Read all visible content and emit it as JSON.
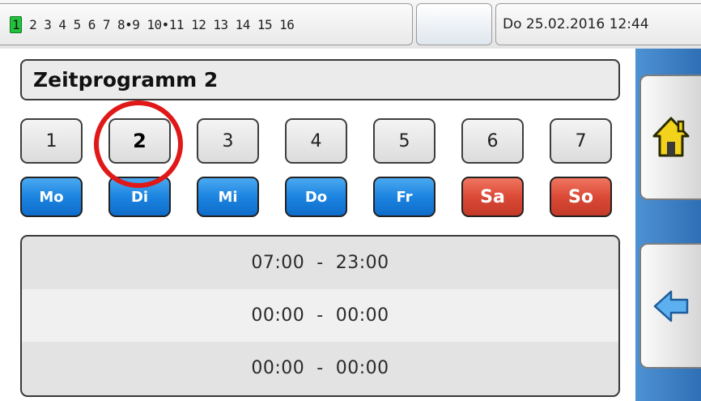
{
  "header": {
    "pages": [
      {
        "label": "1",
        "active": true
      },
      {
        "label": "2"
      },
      {
        "label": "3"
      },
      {
        "label": "4"
      },
      {
        "label": "5"
      },
      {
        "label": "6"
      },
      {
        "label": "7"
      },
      {
        "label": "8•9"
      },
      {
        "label": "10•11"
      },
      {
        "label": "12"
      },
      {
        "label": "13"
      },
      {
        "label": "14"
      },
      {
        "label": "15"
      },
      {
        "label": "16"
      }
    ],
    "datetime": "Do 25.02.2016 12:44"
  },
  "title": "Zeitprogramm 2",
  "program_buttons": [
    {
      "label": "1"
    },
    {
      "label": "2",
      "selected": true
    },
    {
      "label": "3"
    },
    {
      "label": "4"
    },
    {
      "label": "5"
    },
    {
      "label": "6"
    },
    {
      "label": "7"
    }
  ],
  "days": [
    {
      "label": "Mo",
      "color": "#1c84e0"
    },
    {
      "label": "Di",
      "color": "#1c84e0"
    },
    {
      "label": "Mi",
      "color": "#1c84e0"
    },
    {
      "label": "Do",
      "color": "#1c84e0"
    },
    {
      "label": "Fr",
      "color": "#1c84e0"
    },
    {
      "label": "Sa",
      "color": "#db4a36"
    },
    {
      "label": "So",
      "color": "#db4a36"
    }
  ],
  "time_slots": [
    {
      "label": "07:00  -  23:00"
    },
    {
      "label": "00:00  -  00:00"
    },
    {
      "label": "00:00  -  00:00"
    }
  ],
  "sidebar": {
    "home_icon": "home-icon",
    "back_icon": "back-arrow-icon"
  },
  "colors": {
    "accent_blue": "#1c84e0",
    "weekend_red": "#db4a36",
    "active_page_green": "#22c23e",
    "highlight_circle": "#e01818"
  }
}
